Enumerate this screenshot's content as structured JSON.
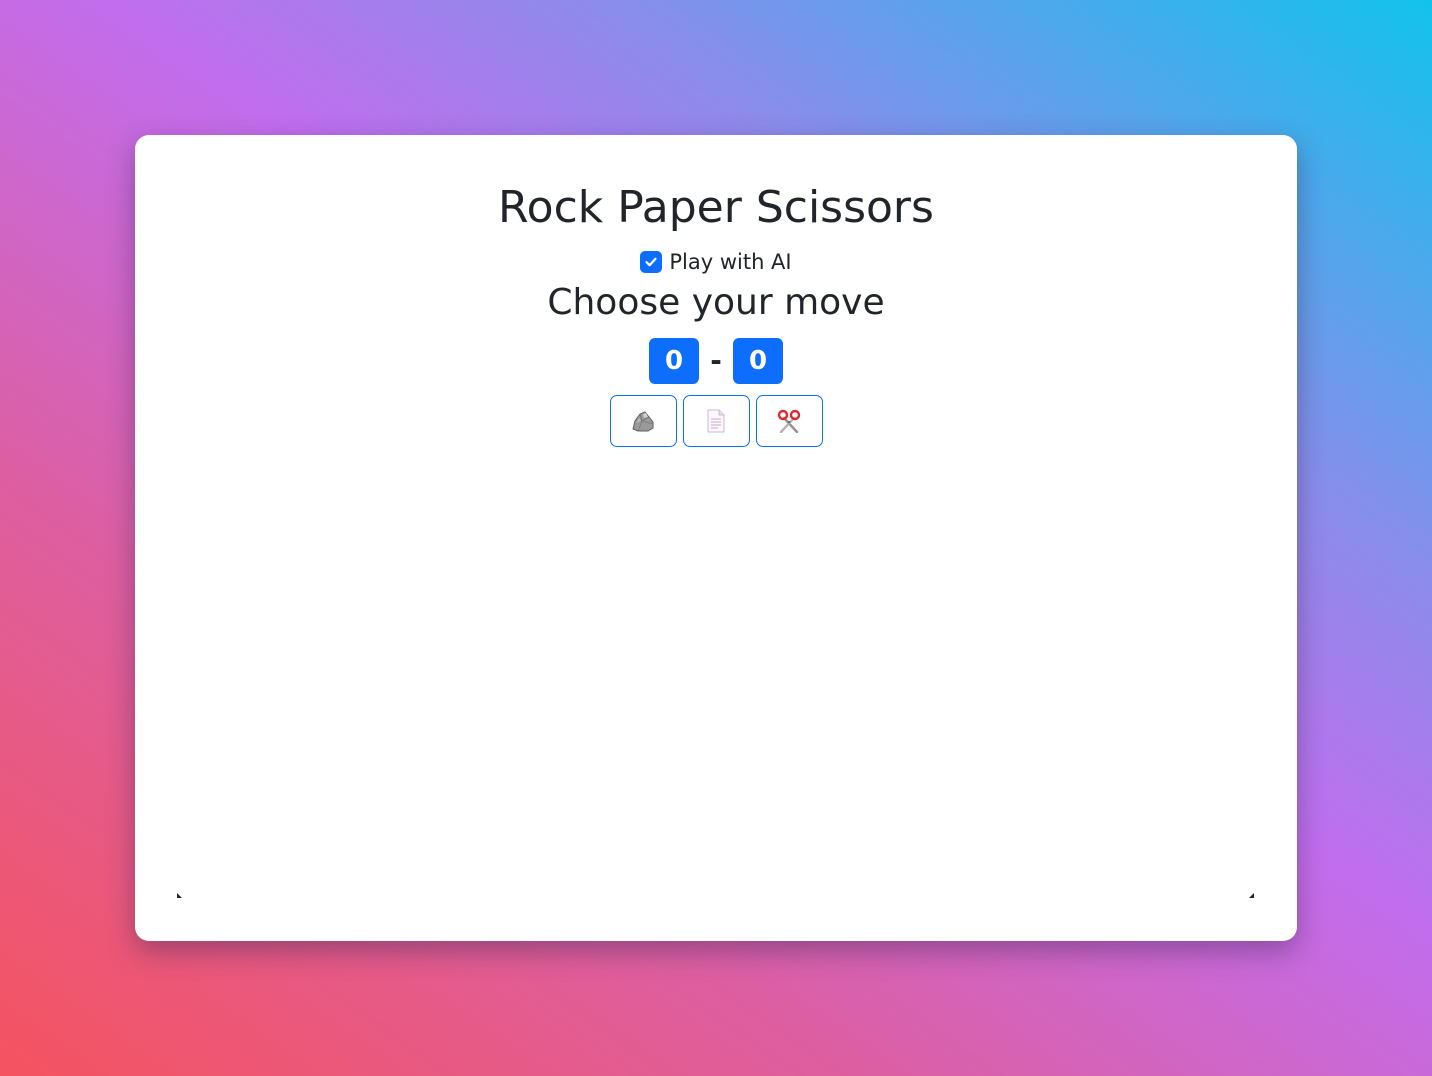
{
  "game": {
    "title": "Rock Paper Scissors",
    "ai_toggle": {
      "label": "Play with AI",
      "checked": true
    },
    "prompt": "Choose your move",
    "score": {
      "player": "0",
      "separator": "-",
      "opponent": "0"
    },
    "moves": [
      {
        "name": "rock",
        "icon": "rock-icon"
      },
      {
        "name": "paper",
        "icon": "paper-icon"
      },
      {
        "name": "scissors",
        "icon": "scissors-icon"
      }
    ]
  },
  "colors": {
    "accent": "#0d6efd",
    "text": "#212529",
    "card": "#ffffff"
  }
}
